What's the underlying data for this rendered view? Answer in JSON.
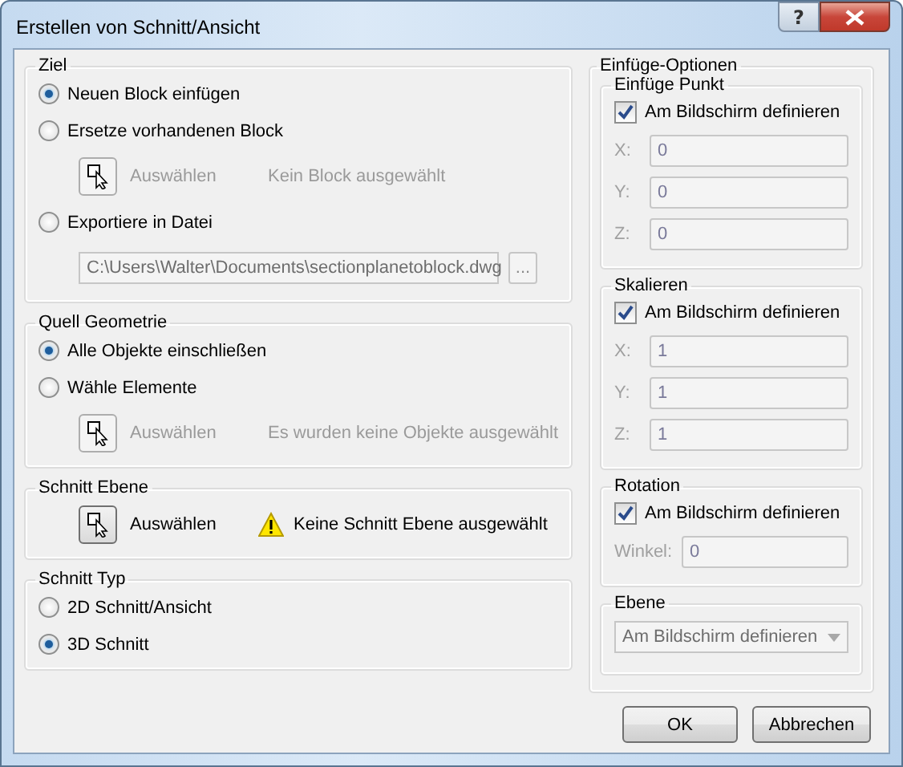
{
  "window": {
    "title": "Erstellen von Schnitt/Ansicht",
    "help": "?"
  },
  "left_groups": [
    {
      "title": "Ziel",
      "items": [
        {
          "kind": "radio",
          "label": "Neuen Block einfügen",
          "selected": true
        },
        {
          "kind": "radio",
          "label": "Ersetze vorhandenen Block",
          "selected": false
        },
        {
          "kind": "pick",
          "button": "Auswählen",
          "status": "Kein Block ausgewählt",
          "disabled": true,
          "warning": false
        },
        {
          "kind": "radio",
          "label": "Exportiere in Datei",
          "selected": false
        },
        {
          "kind": "file",
          "value": "C:\\Users\\Walter\\Documents\\sectionplanetoblock.dwg",
          "browse": "...",
          "disabled": true
        }
      ]
    },
    {
      "title": "Quell Geometrie",
      "items": [
        {
          "kind": "radio",
          "label": "Alle Objekte einschließen",
          "selected": true
        },
        {
          "kind": "radio",
          "label": "Wähle Elemente",
          "selected": false
        },
        {
          "kind": "pick",
          "button": "Auswählen",
          "status": "Es wurden keine Objekte ausgewählt",
          "disabled": true,
          "warning": false
        }
      ]
    },
    {
      "title": "Schnitt Ebene",
      "items": [
        {
          "kind": "pick",
          "button": "Auswählen",
          "status": "Keine Schnitt Ebene ausgewählt",
          "disabled": false,
          "warning": true
        }
      ]
    },
    {
      "title": "Schnitt Typ",
      "items": [
        {
          "kind": "radio",
          "label": "2D Schnitt/Ansicht",
          "selected": false
        },
        {
          "kind": "radio",
          "label": "3D Schnitt",
          "selected": true
        }
      ]
    }
  ],
  "insert_options": {
    "title": "Einfüge-Optionen",
    "groups": [
      {
        "title": "Einfüge Punkt",
        "checkbox": {
          "label": "Am Bildschirm definieren",
          "checked": true
        },
        "fields": [
          {
            "label": "X:",
            "value": "0",
            "disabled": true
          },
          {
            "label": "Y:",
            "value": "0",
            "disabled": true
          },
          {
            "label": "Z:",
            "value": "0",
            "disabled": true
          }
        ]
      },
      {
        "title": "Skalieren",
        "checkbox": {
          "label": "Am Bildschirm definieren",
          "checked": true
        },
        "fields": [
          {
            "label": "X:",
            "value": "1",
            "disabled": true
          },
          {
            "label": "Y:",
            "value": "1",
            "disabled": true
          },
          {
            "label": "Z:",
            "value": "1",
            "disabled": true
          }
        ]
      },
      {
        "title": "Rotation",
        "checkbox": {
          "label": "Am Bildschirm definieren",
          "checked": true
        },
        "fields": [
          {
            "label": "Winkel:",
            "value": "0",
            "disabled": true
          }
        ]
      },
      {
        "title": "Ebene",
        "dropdown": {
          "value": "Am Bildschirm definieren",
          "disabled": true
        }
      }
    ]
  },
  "buttons": [
    {
      "label": "OK"
    },
    {
      "label": "Abbrechen"
    }
  ]
}
